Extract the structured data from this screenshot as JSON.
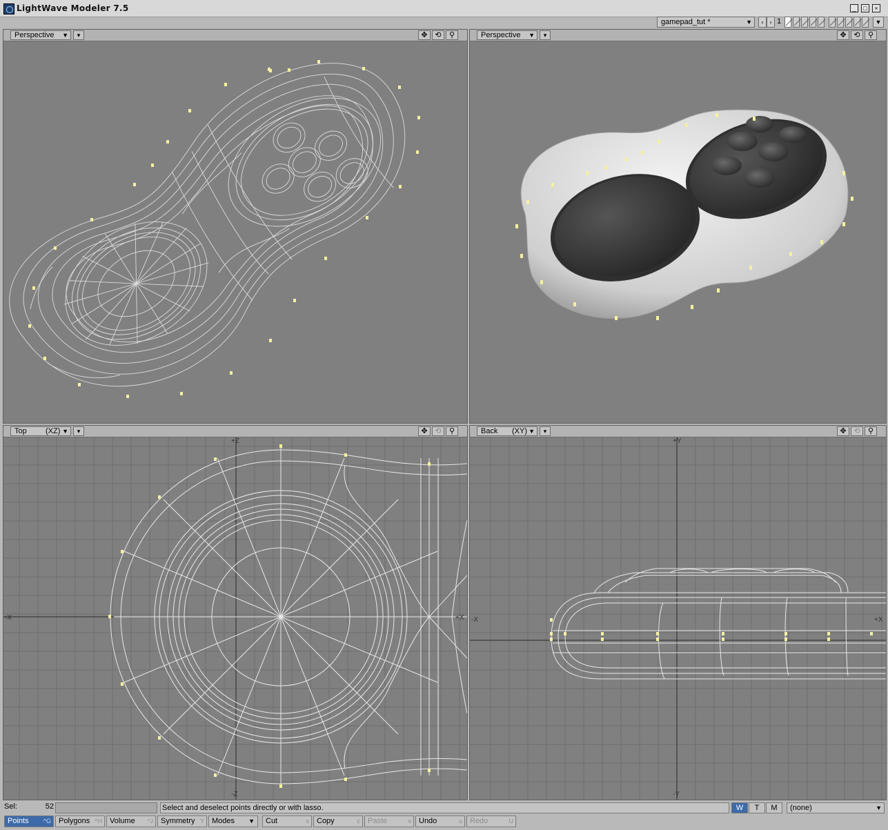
{
  "window": {
    "title": "LightWave Modeler 7.5",
    "minimize": "_",
    "maximize": "□",
    "close": "×"
  },
  "toolbar": {
    "object_name": "gamepad_tut *",
    "prev": "‹",
    "next": "›",
    "layer_number": "1"
  },
  "viewports": {
    "top_left": {
      "view": "Perspective",
      "menu": "▾",
      "move": "✥",
      "rotate": "⟲",
      "zoom": "⚲"
    },
    "top_right": {
      "view": "Perspective",
      "menu": "▾",
      "move": "✥",
      "rotate": "⟲",
      "zoom": "⚲"
    },
    "bottom_left": {
      "view": "Top",
      "axes": "(XZ)",
      "menu": "▾",
      "move": "✥",
      "rotate": "⟲",
      "zoom": "⚲",
      "axis_up": "+Z",
      "axis_down": "-Z",
      "axis_left": "-X",
      "axis_right": "+X"
    },
    "bottom_right": {
      "view": "Back",
      "axes": "(XY)",
      "menu": "▾",
      "move": "✥",
      "rotate": "⟲",
      "zoom": "⚲",
      "axis_up": "+Y",
      "axis_down": "-Y",
      "axis_left": "-X",
      "axis_right": "+X"
    }
  },
  "status": {
    "sel_label": "Sel:",
    "sel_value": "52",
    "help": "Select and deselect points directly or with lasso.",
    "w": "W",
    "t": "T",
    "m": "M",
    "surface": "(none)"
  },
  "bottom_tabs": [
    {
      "label": "Points",
      "key": "^G"
    },
    {
      "label": "Polygons",
      "key": "^H"
    },
    {
      "label": "Volume",
      "key": "^J"
    },
    {
      "label": "Symmetry",
      "key": "Y"
    },
    {
      "label": "Modes",
      "key": ""
    },
    {
      "label": "Cut",
      "key": "x"
    },
    {
      "label": "Copy",
      "key": "c"
    },
    {
      "label": "Paste",
      "key": "v"
    },
    {
      "label": "Undo",
      "key": "u"
    },
    {
      "label": "Redo",
      "key": "U"
    }
  ],
  "colors": {
    "viewport_bg": "#808080",
    "wire": "#e8e8e8",
    "selected_point": "#f4f0a0",
    "active_tab": "#3d6aa9",
    "controller_body": "#d2d2d2",
    "pad_dark": "#3a3a3a"
  }
}
